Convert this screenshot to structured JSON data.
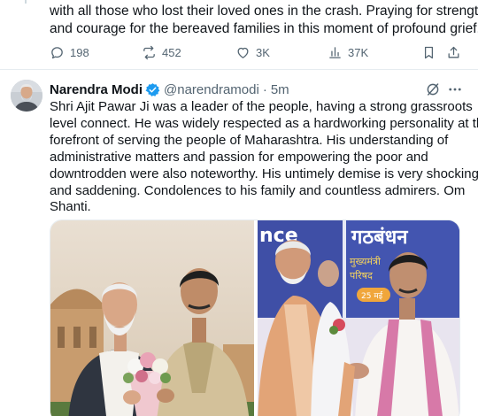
{
  "previous_tweet": {
    "text_lines": [
      "with all those who lost their loved ones in the crash. Praying for strength",
      "and courage for the bereaved families in this moment of profound grief."
    ],
    "actions": {
      "replies": "198",
      "reposts": "452",
      "likes": "3K",
      "views": "37K"
    }
  },
  "tweet": {
    "author_name": "Narendra Modi",
    "handle": "@narendramodi",
    "separator": "·",
    "time": "5m",
    "text_lines": [
      "Shri Ajit Pawar Ji was a leader of the people, having a strong grassroots",
      "level connect. He was widely respected as a hardworking personality at the",
      "forefront of serving the people of Maharashtra. His understanding of",
      "administrative matters and passion for empowering the poor and",
      "downtrodden were also noteworthy. His untimely demise is very shocking",
      "and saddening. Condolences to his family and countless admirers. Om",
      "Shanti."
    ],
    "media": {
      "right_banner_text": "nce",
      "right_banner_hindi": "गठबंधन",
      "right_banner_hindi2": "मुख्यमंत्री",
      "right_banner_hindi3": "परिषद",
      "right_date_badge": "25 मई"
    }
  },
  "colors": {
    "text_primary": "#0f1419",
    "text_secondary": "#536471",
    "verified_blue": "#1d9bf0",
    "divider": "#e6ecf0"
  },
  "icons": {
    "reply": "reply-icon",
    "repost": "repost-icon",
    "like": "heart-icon",
    "views": "views-icon",
    "bookmark": "bookmark-icon",
    "share": "share-icon",
    "verified": "verified-badge-icon",
    "grok": "grok-icon",
    "more": "more-icon"
  }
}
